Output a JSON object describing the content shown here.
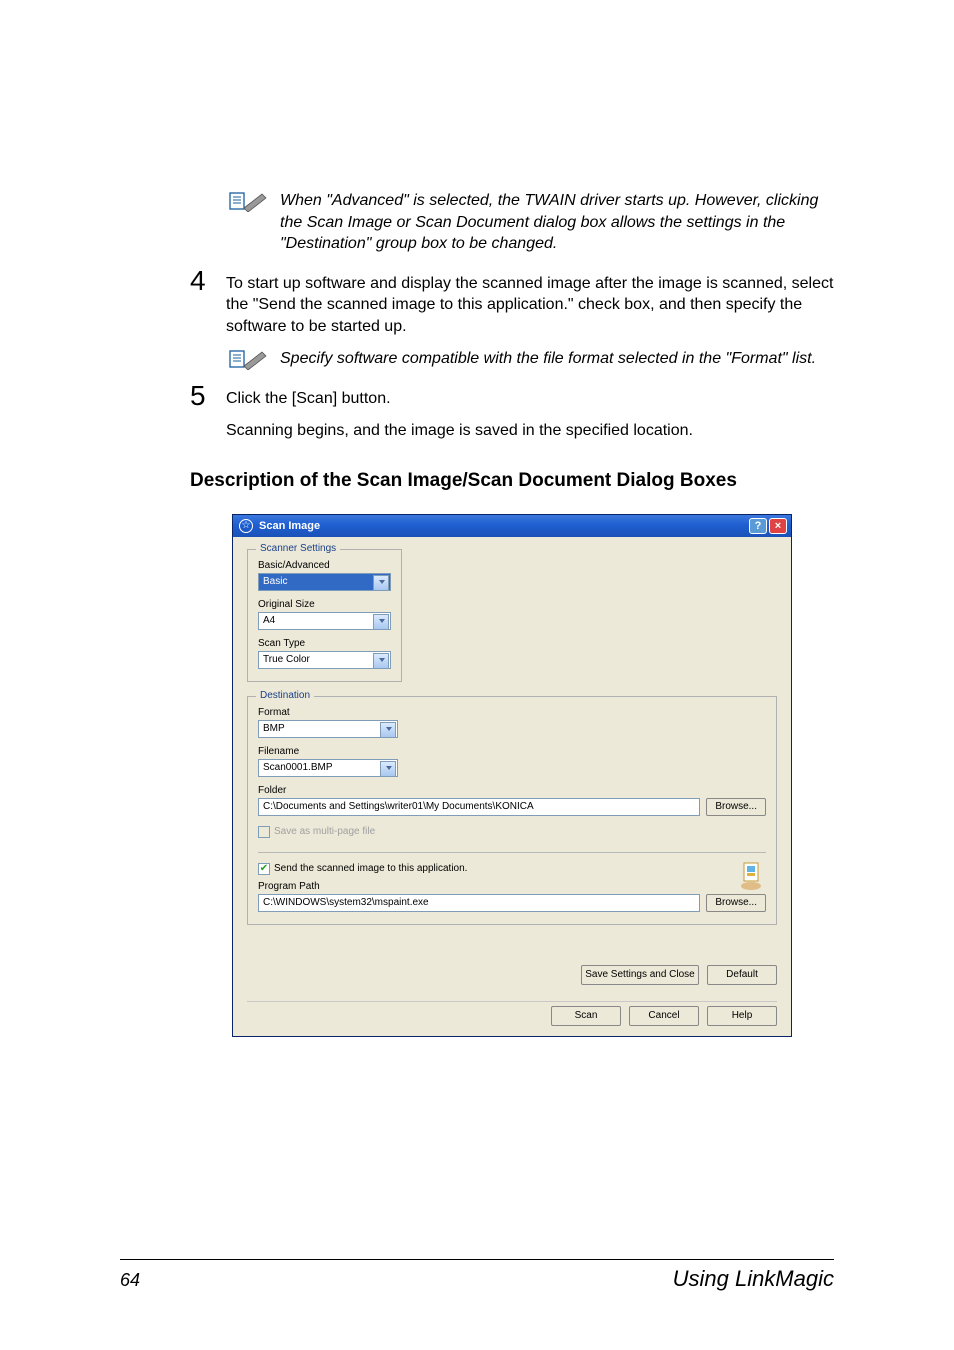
{
  "notes": {
    "note1": "When \"Advanced\" is selected, the TWAIN driver starts up. However, clicking the Scan Image or Scan Document dialog box allows the settings in the \"Destination\" group box to be changed.",
    "note2": "Specify software compatible with the file format selected in the \"Format\" list."
  },
  "steps": {
    "s4": {
      "num": "4",
      "text": "To start up software and display the scanned image after the image is scanned, select the \"Send the scanned image to this application.\" check box, and then specify the software to be started up."
    },
    "s5": {
      "num": "5",
      "text": "Click the [Scan] button.",
      "sub": "Scanning begins, and the image is saved in the specified location."
    }
  },
  "heading": "Description of the Scan Image/Scan Document Dialog Boxes",
  "dialog": {
    "title": "Scan Image",
    "scanner_settings": {
      "legend": "Scanner Settings",
      "basic_advanced_label": "Basic/Advanced",
      "basic_advanced_value": "Basic",
      "original_size_label": "Original Size",
      "original_size_value": "A4",
      "scan_type_label": "Scan Type",
      "scan_type_value": "True Color"
    },
    "destination": {
      "legend": "Destination",
      "format_label": "Format",
      "format_value": "BMP",
      "filename_label": "Filename",
      "filename_value": "Scan0001.BMP",
      "folder_label": "Folder",
      "folder_value": "C:\\Documents and Settings\\writer01\\My Documents\\KONICA",
      "browse1": "Browse...",
      "multipage_label": "Save as multi-page file",
      "send_label": "Send the scanned image to this application.",
      "program_path_label": "Program Path",
      "program_path_value": "C:\\WINDOWS\\system32\\mspaint.exe",
      "browse2": "Browse..."
    },
    "buttons": {
      "save_close": "Save Settings and Close",
      "default": "Default",
      "scan": "Scan",
      "cancel": "Cancel",
      "help": "Help"
    }
  },
  "footer": {
    "page": "64",
    "chapter": "Using LinkMagic"
  }
}
